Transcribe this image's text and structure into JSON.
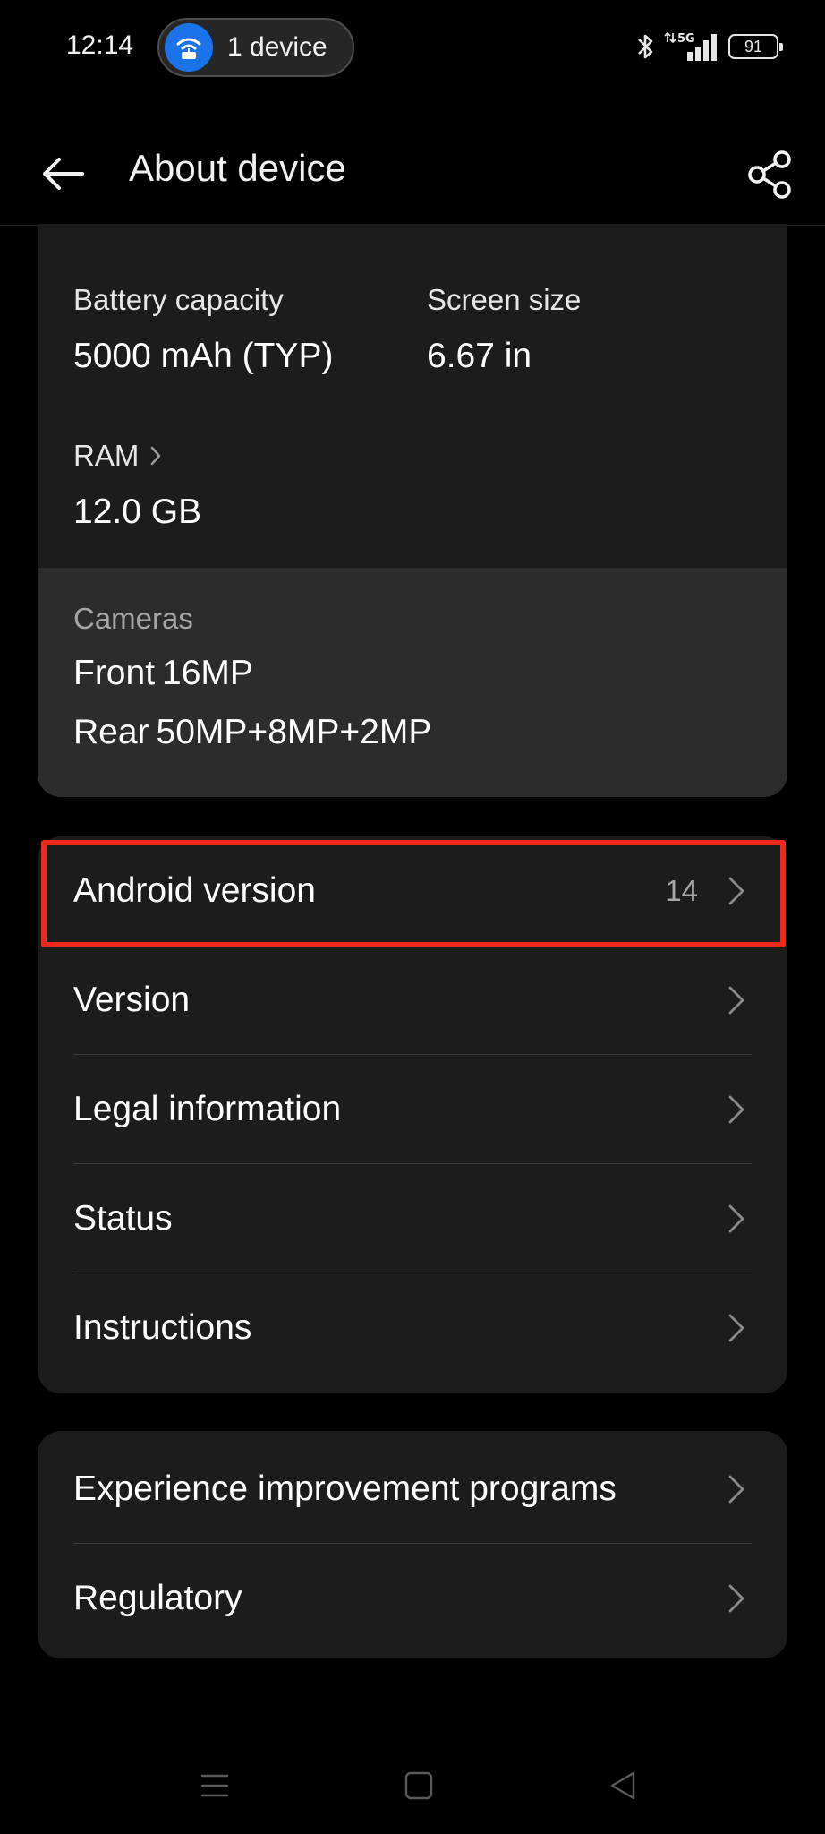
{
  "status_bar": {
    "time": "12:14",
    "hotspot_label": "1 device",
    "network": "5G",
    "battery_level": "91",
    "icons": [
      "wifi-hotspot-icon",
      "bluetooth-icon",
      "signal-icon",
      "battery-icon"
    ]
  },
  "header": {
    "title": "About device",
    "back_icon": "arrow-left-icon",
    "share_icon": "share-icon"
  },
  "specs": {
    "battery": {
      "label": "Battery capacity",
      "value": "5000 mAh (TYP)"
    },
    "screen": {
      "label": "Screen size",
      "value": "6.67 in"
    },
    "ram": {
      "label": "RAM",
      "value": "12.0 GB"
    },
    "cameras": {
      "label": "Cameras",
      "front_label": "Front",
      "front_value": "16MP",
      "rear_label": "Rear",
      "rear_value": "50MP+8MP+2MP"
    }
  },
  "software_list": {
    "items": [
      {
        "label": "Android version",
        "value": "14"
      },
      {
        "label": "Version"
      },
      {
        "label": "Legal information"
      },
      {
        "label": "Status"
      },
      {
        "label": "Instructions"
      }
    ]
  },
  "more_list": {
    "items": [
      {
        "label": "Experience improvement programs"
      },
      {
        "label": "Regulatory"
      }
    ]
  },
  "colors": {
    "background": "#000000",
    "card": "#1c1c1c",
    "cameras_section": "#2c2c2c",
    "highlight": "#f0281e",
    "hotspot_accent": "#1a73e8"
  }
}
